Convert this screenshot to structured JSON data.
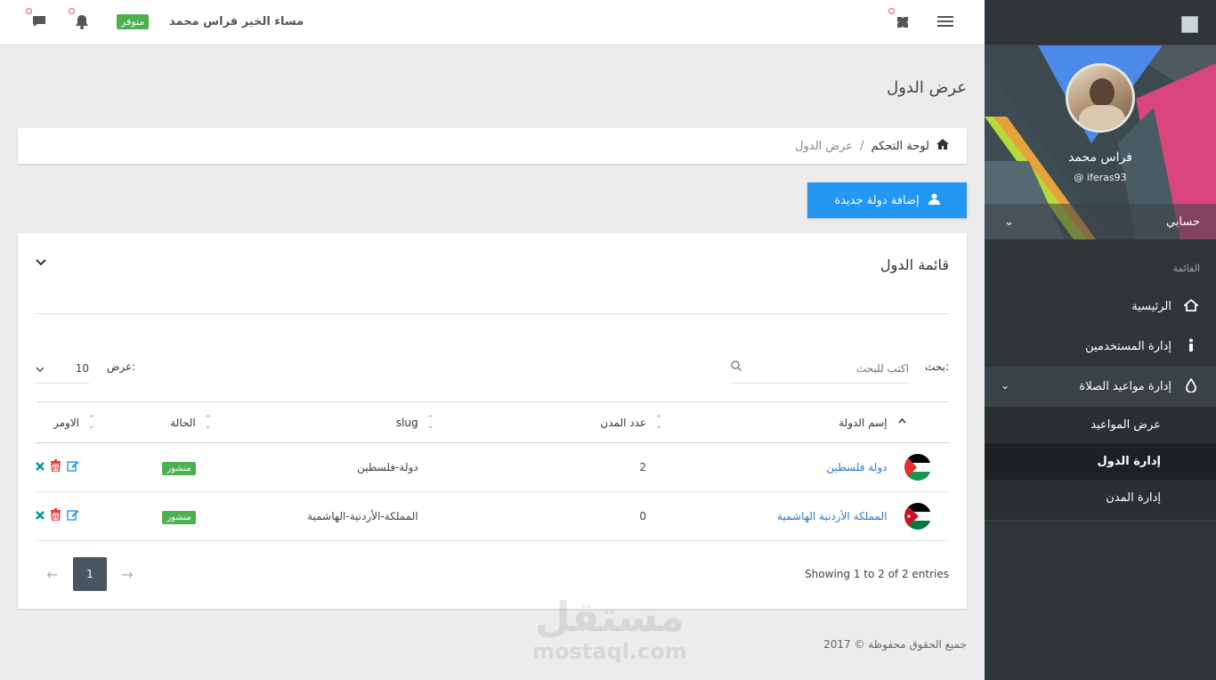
{
  "topbar": {
    "greeting": "مساء الخير فراس محمد",
    "status": "متوفر"
  },
  "sidebar": {
    "name": "فراس محمد",
    "username": "@ iferas93",
    "account_label": "حسابي",
    "section_label": "القائمة",
    "items": [
      {
        "label": "الرئيسية",
        "icon": "home-icon"
      },
      {
        "label": "إدارة المستخدمين",
        "icon": "person-icon"
      },
      {
        "label": "إدارة مواعيد الصلاة",
        "icon": "drop-icon"
      }
    ],
    "subitems": [
      {
        "label": "عرض المواعيد"
      },
      {
        "label": "إدارة الدول"
      },
      {
        "label": "إدارة المدن"
      }
    ]
  },
  "main": {
    "page_title": "عرض الدول",
    "breadcrumb": {
      "home": "لوحة التحكم",
      "sep": "/",
      "current": "عرض الدول"
    },
    "add_button": "إضافة دولة جديدة",
    "card_title": "قائمة الدول",
    "search_label": "بحث:",
    "search_placeholder": "اكتب للبحث",
    "length_label": "عرض:",
    "length_value": "10",
    "columns": [
      "إسم الدولة",
      "عدد المدن",
      "slug",
      "الحالة",
      "الاومر"
    ],
    "rows": [
      {
        "name": "دولة فلسطين",
        "cities": "2",
        "slug": "دولة-فلسطين",
        "status": "منشور",
        "flag": "palestine"
      },
      {
        "name": "المملكة الأردنية الهاشمية",
        "cities": "0",
        "slug": "المملكة-الأردنية-الهاشمية",
        "status": "منشور",
        "flag": "jordan"
      }
    ],
    "info": "Showing 1 to 2 of 2 entries",
    "pagination": {
      "prev": "←",
      "page": "1",
      "next": "→"
    }
  },
  "footer": "جميع الحقوق محفوظة © 2017",
  "watermark": {
    "arabic": "مستقل",
    "latin": "mostaql.com"
  },
  "colors": {
    "primary": "#2196f3",
    "success": "#4caf50",
    "sidebar": "#2f3538",
    "danger": "#e53935"
  }
}
